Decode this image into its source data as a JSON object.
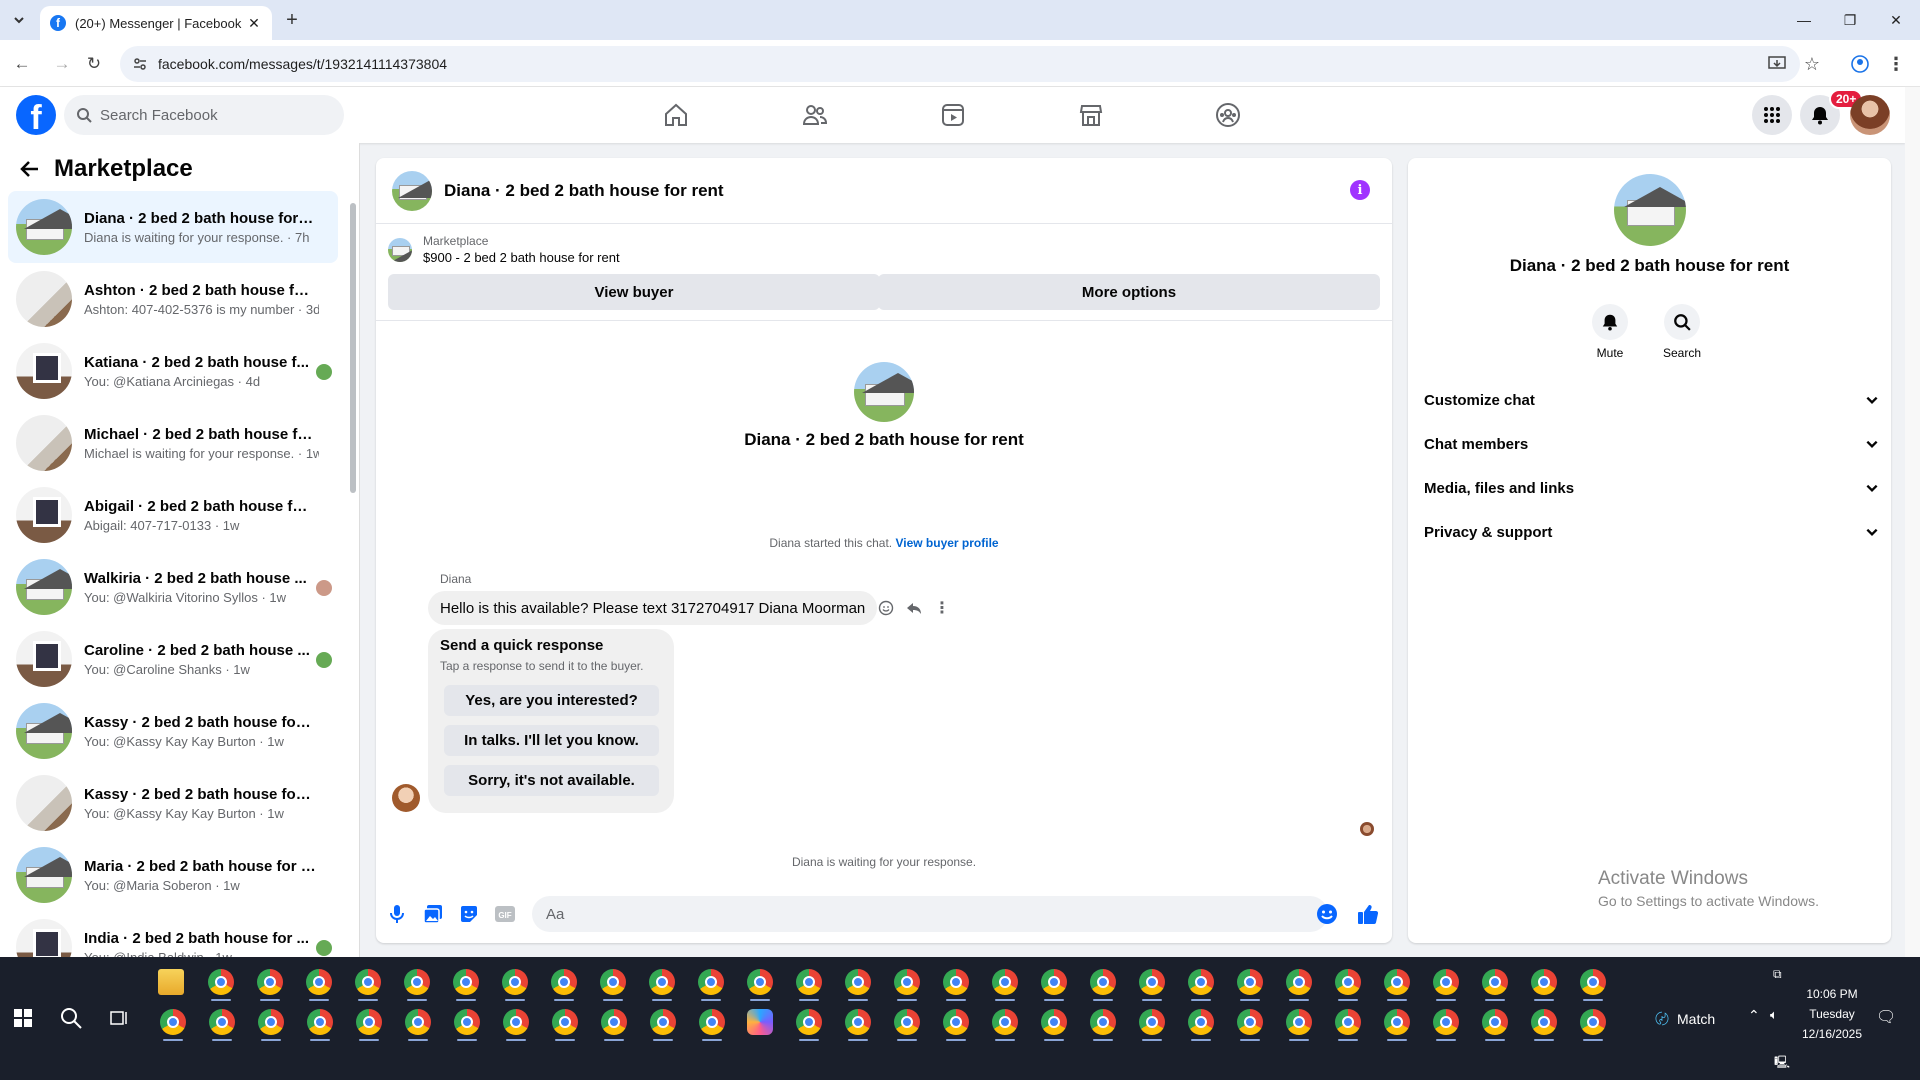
{
  "browser": {
    "tab_title": "(20+) Messenger | Facebook",
    "url": "facebook.com/messages/t/1932141114373804"
  },
  "fb": {
    "search_placeholder": "Search Facebook",
    "notification_badge": "20+"
  },
  "sidebar": {
    "title": "Marketplace",
    "conversations": [
      {
        "name": "Diana · 2 bed 2 bath house for r...",
        "preview": "Diana is waiting for your response. · 7h",
        "thumb": "house",
        "active": true
      },
      {
        "name": "Ashton · 2 bed 2 bath house for ...",
        "preview": "Ashton: 407-402-5376 is my number · 3d",
        "thumb": "room"
      },
      {
        "name": "Katiana · 2 bed 2 bath house f...",
        "preview": "You: @Katiana Arciniegas · 4d",
        "thumb": "room2",
        "mini": true
      },
      {
        "name": "Michael · 2 bed 2 bath house for...",
        "preview": "Michael is waiting for your response. · 1w",
        "thumb": "room"
      },
      {
        "name": "Abigail · 2 bed 2 bath house for ...",
        "preview": "Abigail: 407-717-0133 · 1w",
        "thumb": "room2"
      },
      {
        "name": "Walkiria · 2 bed 2 bath house ...",
        "preview": "You: @Walkiria Vitorino Syllos · 1w",
        "thumb": "house",
        "mini": true
      },
      {
        "name": "Caroline · 2 bed 2 bath house ...",
        "preview": "You: @Caroline Shanks · 1w",
        "thumb": "room2",
        "mini": true
      },
      {
        "name": "Kassy · 2 bed 2 bath house for r...",
        "preview": "You: @Kassy Kay Kay Burton · 1w",
        "thumb": "house"
      },
      {
        "name": "Kassy · 2 bed 2 bath house for r...",
        "preview": "You: @Kassy Kay Kay Burton · 1w",
        "thumb": "room"
      },
      {
        "name": "Maria · 2 bed 2 bath house for r...",
        "preview": "You: @Maria Soberon · 1w",
        "thumb": "house"
      },
      {
        "name": "India · 2 bed 2 bath house for ...",
        "preview": "You: @India Baldwin · 1w",
        "thumb": "room2",
        "mini": true
      }
    ]
  },
  "chat": {
    "title": "Diana · 2 bed 2 bath house for rent",
    "listing_source": "Marketplace",
    "listing_detail": "$900 - 2 bed 2 bath house for rent",
    "view_buyer": "View buyer",
    "more_options": "More options",
    "intro_name": "Diana · 2 bed 2 bath house for rent",
    "started_text": "Diana started this chat.",
    "view_buyer_profile": "View buyer profile",
    "sender": "Diana",
    "message": "Hello is this available? Please text 3172704917 Diana Moorman",
    "quick_title": "Send a quick response",
    "quick_sub": "Tap a response to send it to the buyer.",
    "quick_options": [
      "Yes, are you interested?",
      "In talks. I'll let you know.",
      "Sorry, it's not available."
    ],
    "waiting": "Diana is waiting for your response.",
    "input_placeholder": "Aa"
  },
  "details": {
    "name": "Diana · 2 bed 2 bath house for rent",
    "mute": "Mute",
    "search": "Search",
    "sections": [
      "Customize chat",
      "Chat members",
      "Media, files and links",
      "Privacy & support"
    ],
    "activate_title": "Activate Windows",
    "activate_sub": "Go to Settings to activate Windows."
  },
  "taskbar": {
    "weather": "Match",
    "time": "10:06 PM",
    "day": "Tuesday",
    "date": "12/16/2025"
  },
  "colors": {
    "fb_blue": "#0866ff",
    "accent_purple": "#a033ff",
    "badge_red": "#e41e3f"
  }
}
